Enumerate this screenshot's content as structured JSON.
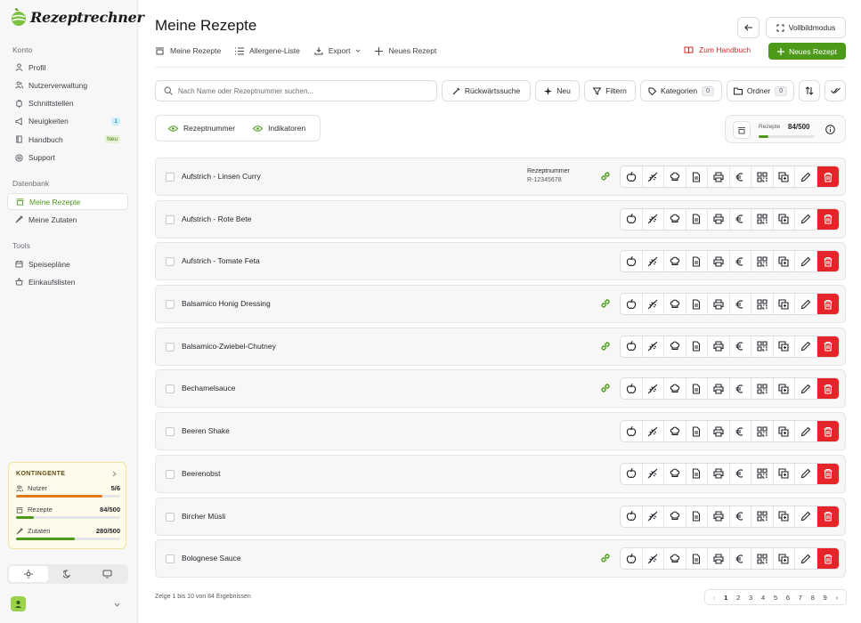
{
  "app": {
    "name": "Rezeptrechner"
  },
  "sidebar": {
    "sections": {
      "konto": "Konto",
      "datenbank": "Datenbank",
      "tools": "Tools"
    },
    "konto": [
      {
        "label": "Profil",
        "icon": "user-icon"
      },
      {
        "label": "Nutzerverwaltung",
        "icon": "users-icon"
      },
      {
        "label": "Schnittstellen",
        "icon": "plug-icon"
      },
      {
        "label": "Neuigkeiten",
        "icon": "megaphone-icon",
        "badge": "1"
      },
      {
        "label": "Handbuch",
        "icon": "book-icon",
        "badge": "Neu"
      },
      {
        "label": "Support",
        "icon": "lifebuoy-icon"
      }
    ],
    "datenbank": [
      {
        "label": "Meine Rezepte",
        "icon": "cooking-pot-icon",
        "active": true
      },
      {
        "label": "Meine Zutaten",
        "icon": "carrot-icon"
      }
    ],
    "tools": [
      {
        "label": "Speisepläne",
        "icon": "calendar-icon"
      },
      {
        "label": "Einkaufslisten",
        "icon": "basket-icon"
      }
    ],
    "quota": {
      "title": "KONTINGENTE",
      "items": [
        {
          "label": "Nutzer",
          "used": "5",
          "total": "6",
          "fill": 0.83,
          "color": "#e0781d"
        },
        {
          "label": "Rezepte",
          "used": "84",
          "total": "500",
          "fill": 0.168,
          "color": "#4d9a1a"
        },
        {
          "label": "Zutaten",
          "used": "280",
          "total": "500",
          "fill": 0.56,
          "color": "#4d9a1a"
        }
      ]
    },
    "theme": [
      "light",
      "dark",
      "system"
    ]
  },
  "header": {
    "title": "Meine Rezepte",
    "fullscreen": "Vollbildmodus",
    "tabs": [
      "Meine Rezepte",
      "Allergene-Liste",
      "Export",
      "Neues Rezept"
    ],
    "handbook": "Zum Handbuch",
    "new_recipe": "Neues Rezept"
  },
  "toolbar": {
    "search_placeholder": "Nach Name oder Rezeptnummer suchen...",
    "reverse": "Rückwärtssuche",
    "new": "Neu",
    "filter": "Filtern",
    "categories": "Kategorien",
    "categories_count": "0",
    "folder": "Ordner",
    "folder_count": "0"
  },
  "toggles": [
    "Rezeptnummer",
    "Indikatoren"
  ],
  "recipe_counter": {
    "label": "Rezepte",
    "used": "84",
    "total": "500",
    "fill": 0.168
  },
  "recipes": [
    {
      "name": "Aufstrich - Linsen Curry",
      "num_label": "Rezeptnummer",
      "num": "R-12345678",
      "linked": true
    },
    {
      "name": "Aufstrich - Rote Bete",
      "linked": false
    },
    {
      "name": "Aufstrich - Tomate Feta",
      "linked": false
    },
    {
      "name": "Balsamico Honig Dressing",
      "linked": true
    },
    {
      "name": "Balsamico-Zwiebel-Chutney",
      "linked": true
    },
    {
      "name": "Bechamelsauce",
      "linked": true
    },
    {
      "name": "Beeren Shake",
      "linked": false
    },
    {
      "name": "Beerenobst",
      "linked": false
    },
    {
      "name": "Bircher Müsli",
      "linked": false
    },
    {
      "name": "Bolognese Sauce",
      "linked": true
    }
  ],
  "row_actions": [
    "apple-icon",
    "no-allergen-icon",
    "chef-hat-icon",
    "document-icon",
    "printer-icon",
    "euro-icon",
    "qr-code-icon",
    "copy-icon",
    "edit-icon",
    "trash-icon"
  ],
  "footer": {
    "summary": "Zeige 1 bis 10 von 84 Ergebnissen",
    "pages": [
      "1",
      "2",
      "3",
      "4",
      "5",
      "6",
      "7",
      "8",
      "9"
    ]
  }
}
